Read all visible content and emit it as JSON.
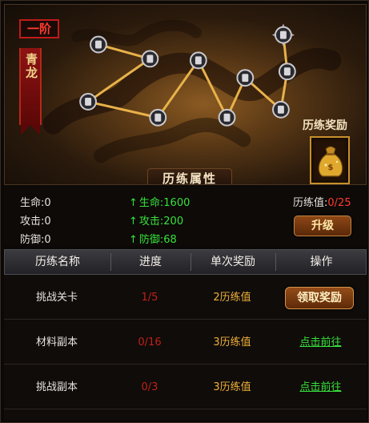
{
  "rank": {
    "label": "一阶"
  },
  "constellation": {
    "name": "青龙",
    "reward_title": "历练奖励",
    "reward_item_icon": "money-bag-icon",
    "attr_title": "历练属性"
  },
  "stats": {
    "base": [
      {
        "label": "生命:0"
      },
      {
        "label": "攻击:0"
      },
      {
        "label": "防御:0"
      }
    ],
    "bonus": [
      {
        "label": "生命:1600"
      },
      {
        "label": "攻击:200"
      },
      {
        "label": "防御:68"
      }
    ],
    "exp_label": "历练值:",
    "exp_value": "0/25",
    "upgrade_label": "升级"
  },
  "table": {
    "headers": [
      "历练名称",
      "进度",
      "单次奖励",
      "操作"
    ],
    "rows": [
      {
        "name": "挑战关卡",
        "progress": "1/5",
        "reward": "2历练值",
        "action": "领取奖励",
        "action_type": "button"
      },
      {
        "name": "材料副本",
        "progress": "0/16",
        "reward": "3历练值",
        "action": "点击前往",
        "action_type": "link"
      },
      {
        "name": "挑战副本",
        "progress": "0/3",
        "reward": "3历练值",
        "action": "点击前往",
        "action_type": "link"
      }
    ]
  },
  "colors": {
    "accent_red": "#ff3b2e",
    "bonus_green": "#37e23a",
    "reward_orange": "#f0b03a",
    "constellation_line": "#e8b24a"
  }
}
